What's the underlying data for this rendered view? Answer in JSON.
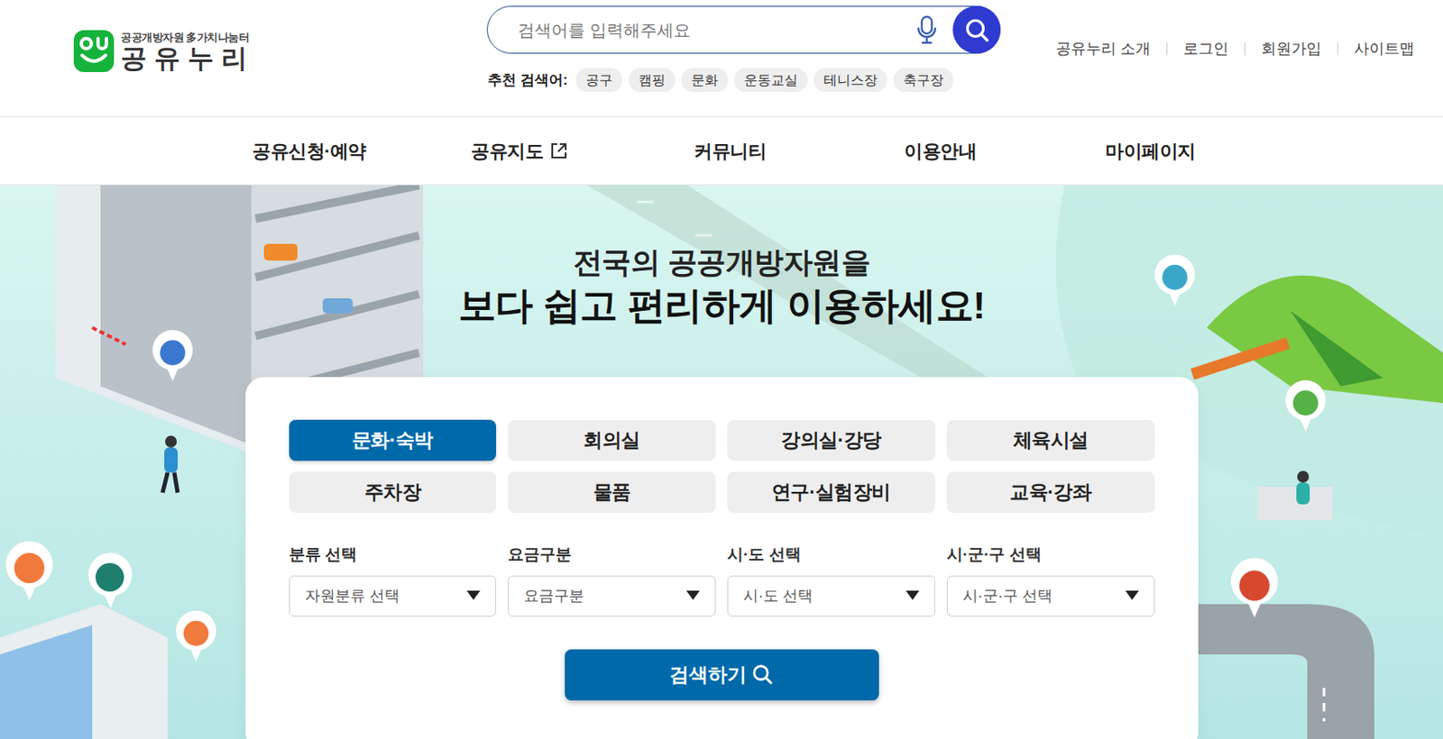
{
  "logo": {
    "subtitle": "공공개방자원 多가치나눔터",
    "title": "공유누리"
  },
  "search": {
    "placeholder": "검색어를 입력해주세요"
  },
  "recommended": {
    "label": "추천 검색어:",
    "tags": [
      "공구",
      "캠핑",
      "문화",
      "운동교실",
      "테니스장",
      "축구장"
    ]
  },
  "util_links": [
    "공유누리 소개",
    "로그인",
    "회원가입",
    "사이트맵"
  ],
  "nav": [
    {
      "label": "공유신청·예약",
      "external": false
    },
    {
      "label": "공유지도",
      "external": true
    },
    {
      "label": "커뮤니티",
      "external": false
    },
    {
      "label": "이용안내",
      "external": false
    },
    {
      "label": "마이페이지",
      "external": false
    }
  ],
  "hero": {
    "line1": "전국의 공공개방자원을",
    "line2": "보다 쉽고 편리하게 이용하세요!"
  },
  "categories": [
    {
      "label": "문화·숙박",
      "selected": true
    },
    {
      "label": "회의실",
      "selected": false
    },
    {
      "label": "강의실·강당",
      "selected": false
    },
    {
      "label": "체육시설",
      "selected": false
    },
    {
      "label": "주차장",
      "selected": false
    },
    {
      "label": "물품",
      "selected": false
    },
    {
      "label": "연구·실험장비",
      "selected": false
    },
    {
      "label": "교육·강좌",
      "selected": false
    }
  ],
  "filters": [
    {
      "label": "분류 선택",
      "placeholder": "자원분류 선택"
    },
    {
      "label": "요금구분",
      "placeholder": "요금구분"
    },
    {
      "label": "시·도 선택",
      "placeholder": "시·도 선택"
    },
    {
      "label": "시·군·구 선택",
      "placeholder": "시·군·구 선택"
    }
  ],
  "search_button": "검색하기"
}
